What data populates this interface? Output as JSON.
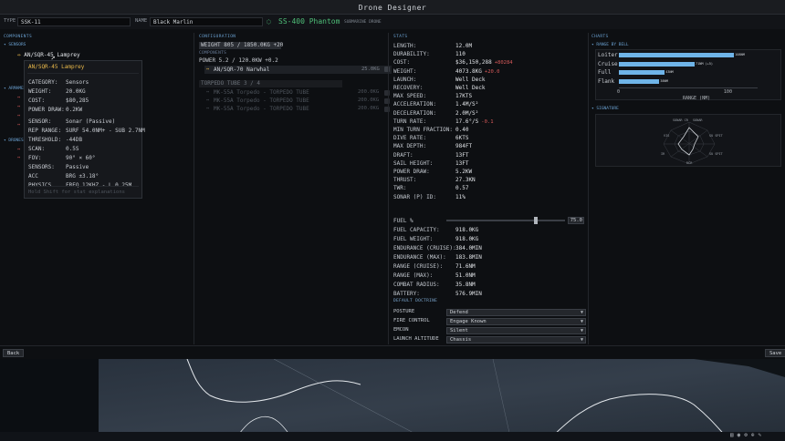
{
  "window": {
    "title": "Drone Designer"
  },
  "topbar": {
    "type_label": "TYPE",
    "type_value": "SSK-11",
    "name_label": "NAME",
    "name_value": "Black Marlin",
    "model_name": "SS-400 Phantom",
    "model_class": "SUBMARINE DRONE"
  },
  "components": {
    "title": "COMPONENTS",
    "sensors_label": "SENSORS",
    "armament_label": "ARMAMENT",
    "drones_label": "DRONES",
    "hovered_item": "AN/SQR-45 Lamprey"
  },
  "tooltip": {
    "title": "AN/SQR-45 Lamprey",
    "rows": [
      {
        "k": "CATEGORY:",
        "v": "Sensors"
      },
      {
        "k": "WEIGHT:",
        "v": "20.0KG"
      },
      {
        "k": "COST:",
        "v": "$80,285"
      },
      {
        "k": "POWER DRAW:",
        "v": "0.2KW"
      },
      {
        "k": "SENSOR:",
        "v": "Sonar (Passive)"
      },
      {
        "k": "REP RANGE:",
        "v": "SURF 54.0NM+ - SUB 2.7NM"
      },
      {
        "k": "THRESHOLD:",
        "v": "-44DB"
      },
      {
        "k": "SCAN:",
        "v": "0.5S"
      },
      {
        "k": "FOV:",
        "v": "90° × 60°"
      },
      {
        "k": "SENSORS:",
        "v": "Passive"
      },
      {
        "k": "ACC",
        "v": "BRG ±3.18°"
      },
      {
        "k": "PHYSICS",
        "v": "FREQ 12KHZ - L 0.25M"
      }
    ],
    "hint": "Hold Shift for stat explanations"
  },
  "configuration": {
    "title": "CONFIGURATION",
    "weight_line": "WEIGHT 805 / 1850.0KG +20",
    "power_line": "POWER 5.2 / 120.0KW +0.2",
    "components_label": "COMPONENTS",
    "installed": [
      {
        "name": "AN/SQR-70 Narwhal",
        "weight": "25.0KG"
      }
    ],
    "torpedo_header": "TORPEDO TUBE 3 / 4",
    "torpedo_rows": [
      {
        "name": "MK-55A Torpedo - TORPEDO TUBE",
        "weight": "200.0KG"
      },
      {
        "name": "MK-55A Torpedo - TORPEDO TUBE",
        "weight": "200.0KG"
      },
      {
        "name": "MK-55A Torpedo - TORPEDO TUBE",
        "weight": "200.0KG"
      }
    ]
  },
  "stats": {
    "title": "STATS",
    "rows": [
      {
        "k": "LENGTH:",
        "v": "12.0M"
      },
      {
        "k": "DURABILITY:",
        "v": "110"
      },
      {
        "k": "COST:",
        "v": "$36,150,288",
        "d": "+80284",
        "dc": "red"
      },
      {
        "k": "WEIGHT:",
        "v": "4073.8KG",
        "d": "+20.0",
        "dc": "red"
      },
      {
        "k": "LAUNCH:",
        "v": "Well Deck"
      },
      {
        "k": "RECOVERY:",
        "v": "Well Deck"
      },
      {
        "k": "MAX SPEED:",
        "v": "17KTS"
      },
      {
        "k": "ACCELERATION:",
        "v": "1.4M/S²"
      },
      {
        "k": "DECELERATION:",
        "v": "2.0M/S²"
      },
      {
        "k": "TURN RATE:",
        "v": "17.6°/S",
        "d": "-0.1",
        "dc": "red"
      },
      {
        "k": "MIN TURN FRACTION:",
        "v": "0.40"
      },
      {
        "k": "DIVE RATE:",
        "v": "6KTS"
      },
      {
        "k": "MAX DEPTH:",
        "v": "984FT"
      },
      {
        "k": "DRAFT:",
        "v": "13FT"
      },
      {
        "k": "SAIL HEIGHT:",
        "v": "13FT"
      },
      {
        "k": "POWER DRAW:",
        "v": "5.2KW"
      },
      {
        "k": "THRUST:",
        "v": "27.3KN"
      },
      {
        "k": "TWR:",
        "v": "0.57"
      },
      {
        "k": "SONAR (P) ID:",
        "v": "11%"
      }
    ],
    "fuel_label": "FUEL %",
    "fuel_value": "75.0",
    "fuel_fraction": 0.75,
    "fuel_rows": [
      {
        "k": "FUEL CAPACITY:",
        "v": "918.0KG"
      },
      {
        "k": "FUEL WEIGHT:",
        "v": "918.0KG"
      },
      {
        "k": "ENDURANCE (CRUISE):",
        "v": "384.0MIN"
      },
      {
        "k": "ENDURANCE (MAX):",
        "v": "183.8MIN"
      },
      {
        "k": "RANGE (CRUISE):",
        "v": "71.6NM"
      },
      {
        "k": "RANGE (MAX):",
        "v": "51.0NM"
      },
      {
        "k": "COMBAT RADIUS:",
        "v": "35.8NM"
      },
      {
        "k": "BATTERY:",
        "v": "576.9MIN"
      }
    ],
    "doctrine_label": "DEFAULT DOCTRINE",
    "doctrine": [
      {
        "k": "POSTURE",
        "v": "Defend"
      },
      {
        "k": "FIRE CONTROL",
        "v": "Engage Known"
      },
      {
        "k": "EMCON",
        "v": "Silent"
      },
      {
        "k": "LAUNCH ALTITUDE",
        "v": "Chassis"
      }
    ]
  },
  "charts": {
    "title": "CHARTS",
    "range_title": "RANGE BY BELL",
    "signature_title": "SIGNATURE",
    "range_axis_label": "RANGE (NM)",
    "signature_labels": [
      "SONAR CR",
      "SONAR",
      "SU SPIT",
      "SU SPIT",
      "RCR",
      "IR",
      "VIS"
    ]
  },
  "chart_data": {
    "type": "bar",
    "title": "RANGE BY BELL",
    "categories": [
      "Loiter",
      "Cruise",
      "Full",
      "Flank"
    ],
    "values": [
      108,
      71,
      43,
      38
    ],
    "value_labels": [
      "108NM",
      "71NM (+5)",
      "43NM",
      "38NM"
    ],
    "xlabel": "RANGE (NM)",
    "xlim": [
      0,
      130
    ],
    "xticks": [
      0,
      100
    ]
  },
  "footer": {
    "back": "Back",
    "save": "Save"
  },
  "colors": {
    "accent": "#6fb4e8",
    "positive": "#4fbf78",
    "negative": "#d85a5a",
    "highlight": "#e8b84a"
  }
}
